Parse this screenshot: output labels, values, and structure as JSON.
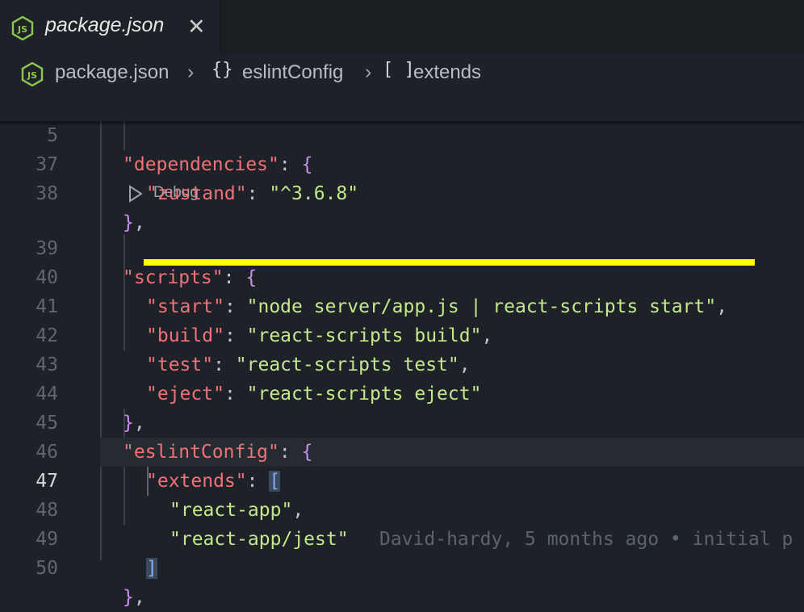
{
  "tab": {
    "title": "package.json",
    "close_glyph": "✕",
    "icon": "nodejs-icon"
  },
  "breadcrumb": {
    "file": "package.json",
    "separator": "›",
    "object_icon": "{}",
    "object": "eslintConfig",
    "array_icon": "[ ]",
    "array": "extends"
  },
  "sticky": {
    "line_number": "5",
    "key": "\"dependencies\"",
    "colon": ": ",
    "brace": "{"
  },
  "codelens": {
    "label": "Debug"
  },
  "lines": [
    {
      "n": "37",
      "key": "\"zustand\"",
      "value": "\"^3.6.8\""
    },
    {
      "n": "38",
      "text": "},"
    },
    {
      "n": "39",
      "key": "\"scripts\"",
      "brace": "{"
    },
    {
      "n": "40",
      "key": "\"start\"",
      "value": "\"node server/app.js | react-scripts start\"",
      "tail": ","
    },
    {
      "n": "41",
      "key": "\"build\"",
      "value": "\"react-scripts build\"",
      "tail": ","
    },
    {
      "n": "42",
      "key": "\"test\"",
      "value": "\"react-scripts test\"",
      "tail": ","
    },
    {
      "n": "43",
      "key": "\"eject\"",
      "value": "\"react-scripts eject\""
    },
    {
      "n": "44",
      "text": "},"
    },
    {
      "n": "45",
      "key": "\"eslintConfig\"",
      "brace": "{"
    },
    {
      "n": "46",
      "key": "\"extends\"",
      "bracket": "["
    },
    {
      "n": "47",
      "value": "\"react-app\"",
      "tail": ",",
      "blame": "David-hardy, 5 months ago • initial p"
    },
    {
      "n": "48",
      "value": "\"react-app/jest\""
    },
    {
      "n": "49",
      "bracket": "]"
    },
    {
      "n": "50",
      "text": "},"
    }
  ],
  "colors": {
    "background": "#1e2228",
    "key": "#f07178",
    "string": "#c3e88d",
    "brace": "#c792ea",
    "annotation": "#ffff00"
  }
}
